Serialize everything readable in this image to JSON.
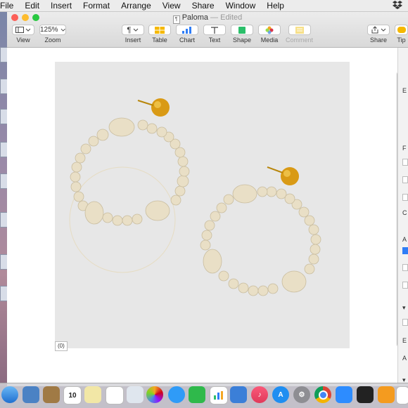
{
  "menubar": {
    "items": [
      "File",
      "Edit",
      "Insert",
      "Format",
      "Arrange",
      "View",
      "Share",
      "Window",
      "Help"
    ]
  },
  "window": {
    "title": "Paloma",
    "status": "— Edited"
  },
  "toolbar": {
    "view_label": "View",
    "zoom_value": "125%",
    "zoom_label": "Zoom",
    "insert_label": "Insert",
    "table_label": "Table",
    "chart_label": "Chart",
    "text_label": "Text",
    "shape_label": "Shape",
    "media_label": "Media",
    "comment_label": "Comment",
    "share_label": "Share",
    "tips_label": "Tip"
  },
  "canvas": {
    "counter": "(0)",
    "image_description_icon": "earrings-image"
  },
  "inspector": {
    "letters": [
      "E",
      "F",
      "C",
      "A",
      "E",
      "A"
    ]
  },
  "colors": {
    "red": "#fc5f57",
    "yellow": "#fdbc2e",
    "green": "#28c840",
    "accent": "#2f7df6"
  },
  "dock": {
    "icons": [
      "finder-icon",
      "preview-icon",
      "notes-icon",
      "calendar-icon",
      "stickies-icon",
      "reminders-icon",
      "photos-icon",
      "photos-app-icon",
      "messages-icon",
      "facetime-icon",
      "numbers-icon",
      "keynote-icon",
      "music-icon",
      "app-store-icon",
      "system-preferences-icon",
      "chrome-icon",
      "zoom-icon",
      "piano-icon",
      "pages-icon",
      "textedit-icon"
    ],
    "calendar_day": "10"
  }
}
